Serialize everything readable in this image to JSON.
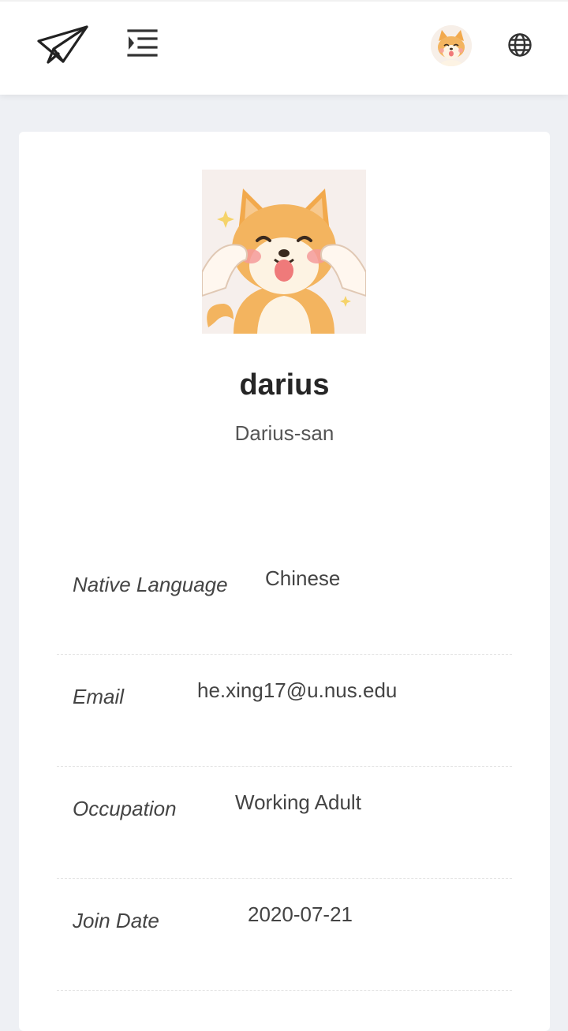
{
  "header": {
    "logo_icon": "paper-plane-icon",
    "menu_icon": "indent-menu-icon",
    "avatar_icon": "shiba-avatar",
    "language_icon": "globe-icon"
  },
  "profile": {
    "username": "darius",
    "nickname": "Darius-san",
    "picture": "shiba-dog-picture"
  },
  "details": [
    {
      "label": "Native Language",
      "value": "Chinese"
    },
    {
      "label": "Email",
      "value": "he.xing17@u.nus.edu"
    },
    {
      "label": "Occupation",
      "value": "Working Adult"
    },
    {
      "label": "Join Date",
      "value": "2020-07-21"
    }
  ],
  "colors": {
    "background": "#eef0f4",
    "card": "#ffffff",
    "shiba_orange": "#f2b25c",
    "text": "#333333"
  }
}
